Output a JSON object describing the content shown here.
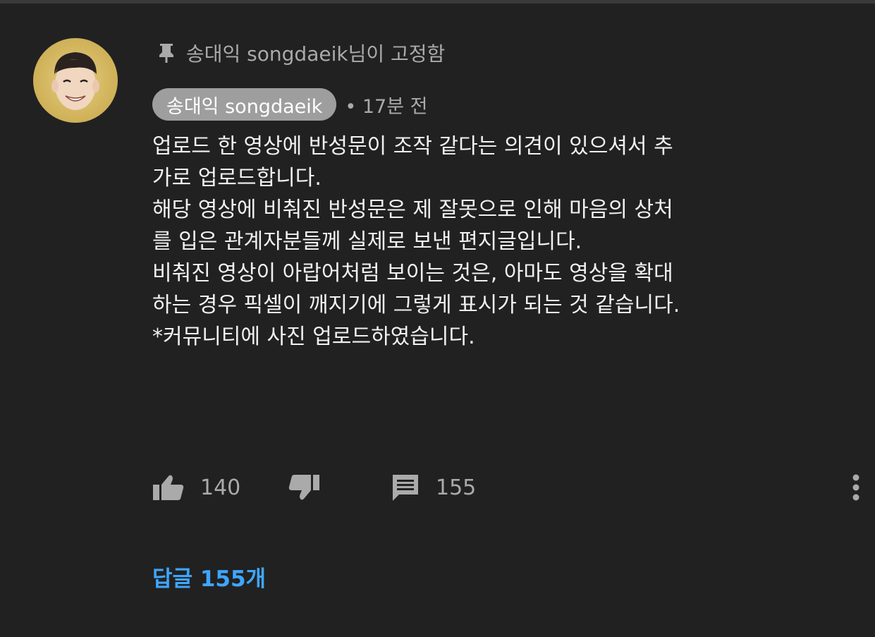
{
  "pinned": {
    "icon": "pin-icon",
    "text": "송대익 songdaeik님이 고정함"
  },
  "comment": {
    "author": "송대익 songdaeik",
    "timestamp": "• 17분 전",
    "lines": [
      "업로드 한 영상에 반성문이 조작 같다는 의견이 있으셔서 추",
      "가로 업로드합니다.",
      "해당 영상에 비춰진 반성문은 제 잘못으로 인해  마음의 상처",
      "를 입은 관계자분들께 실제로 보낸 편지글입니다.",
      "비춰진 영상이 아랍어처럼 보이는 것은, 아마도 영상을 확대",
      "하는 경우 픽셀이 깨지기에 그렇게 표시가 되는 것 같습니다.",
      "*커뮤니티에 사진 업로드하였습니다."
    ],
    "likes": "140",
    "reply_count": "155",
    "replies_link": "답글 155개"
  },
  "colors": {
    "background": "#212121",
    "secondary_text": "#aaaaaa",
    "author_chip": "#9e9e9e",
    "link_blue": "#3ea6ff"
  }
}
